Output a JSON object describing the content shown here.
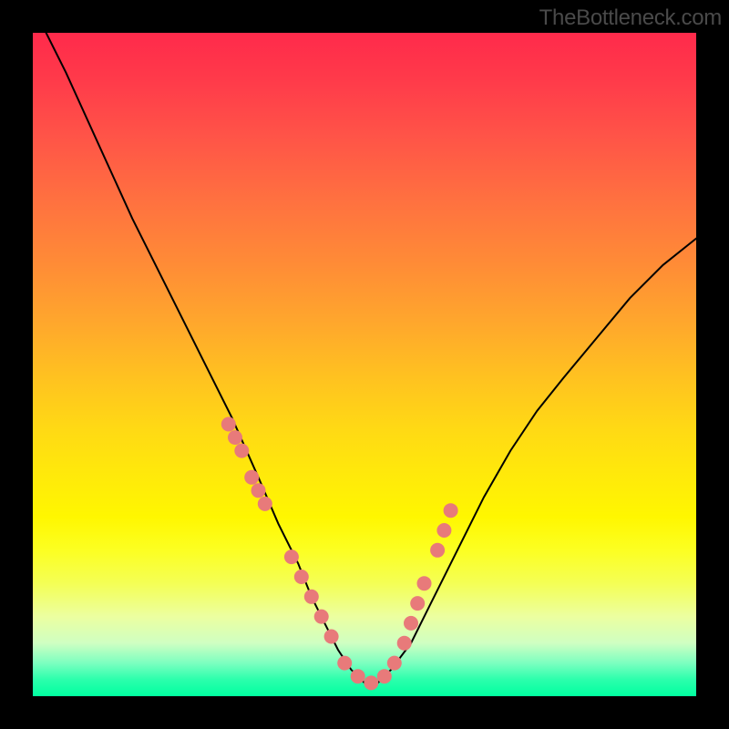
{
  "watermark": "TheBottleneck.com",
  "colors": {
    "background": "#000000",
    "curve": "#000000",
    "points": "#e87a7a"
  },
  "chart_data": {
    "type": "line",
    "title": "",
    "xlabel": "",
    "ylabel": "",
    "xlim": [
      0,
      100
    ],
    "ylim": [
      0,
      100
    ],
    "curve": {
      "x": [
        2,
        5,
        10,
        15,
        20,
        25,
        30,
        34,
        37,
        40,
        42,
        44,
        46,
        48,
        50,
        52,
        54,
        57,
        60,
        64,
        68,
        72,
        76,
        80,
        85,
        90,
        95,
        100
      ],
      "y": [
        100,
        94,
        83,
        72,
        62,
        52,
        42,
        33,
        26,
        20,
        15,
        11,
        7,
        4,
        2,
        2,
        4,
        8,
        14,
        22,
        30,
        37,
        43,
        48,
        54,
        60,
        65,
        69
      ]
    },
    "series": [
      {
        "name": "data-points",
        "x": [
          29.5,
          30.5,
          31.5,
          33,
          34,
          35,
          39,
          40.5,
          42,
          43.5,
          45,
          47,
          49,
          51,
          53,
          54.5,
          56,
          57,
          58,
          59,
          61,
          62,
          63
        ],
        "y": [
          41,
          39,
          37,
          33,
          31,
          29,
          21,
          18,
          15,
          12,
          9,
          5,
          3,
          2,
          3,
          5,
          8,
          11,
          14,
          17,
          22,
          25,
          28
        ]
      }
    ]
  }
}
